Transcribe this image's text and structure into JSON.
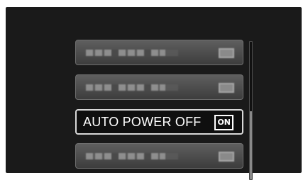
{
  "menu": {
    "items": [
      {
        "label": "",
        "value": "",
        "state": "blurred"
      },
      {
        "label": "",
        "value": "",
        "state": "blurred"
      },
      {
        "label": "AUTO POWER OFF",
        "value": "ON",
        "state": "selected"
      },
      {
        "label": "",
        "value": "",
        "state": "blurred"
      }
    ]
  },
  "scrollbar": {
    "position_fraction": 0.5,
    "visible_fraction": 0.5
  },
  "colors": {
    "background": "#1a1a1a",
    "item_gradient_top": "#5f5f5f",
    "selected_background": "#0f0f0f",
    "selected_border": "#d8d8d8",
    "text": "#ffffff"
  }
}
